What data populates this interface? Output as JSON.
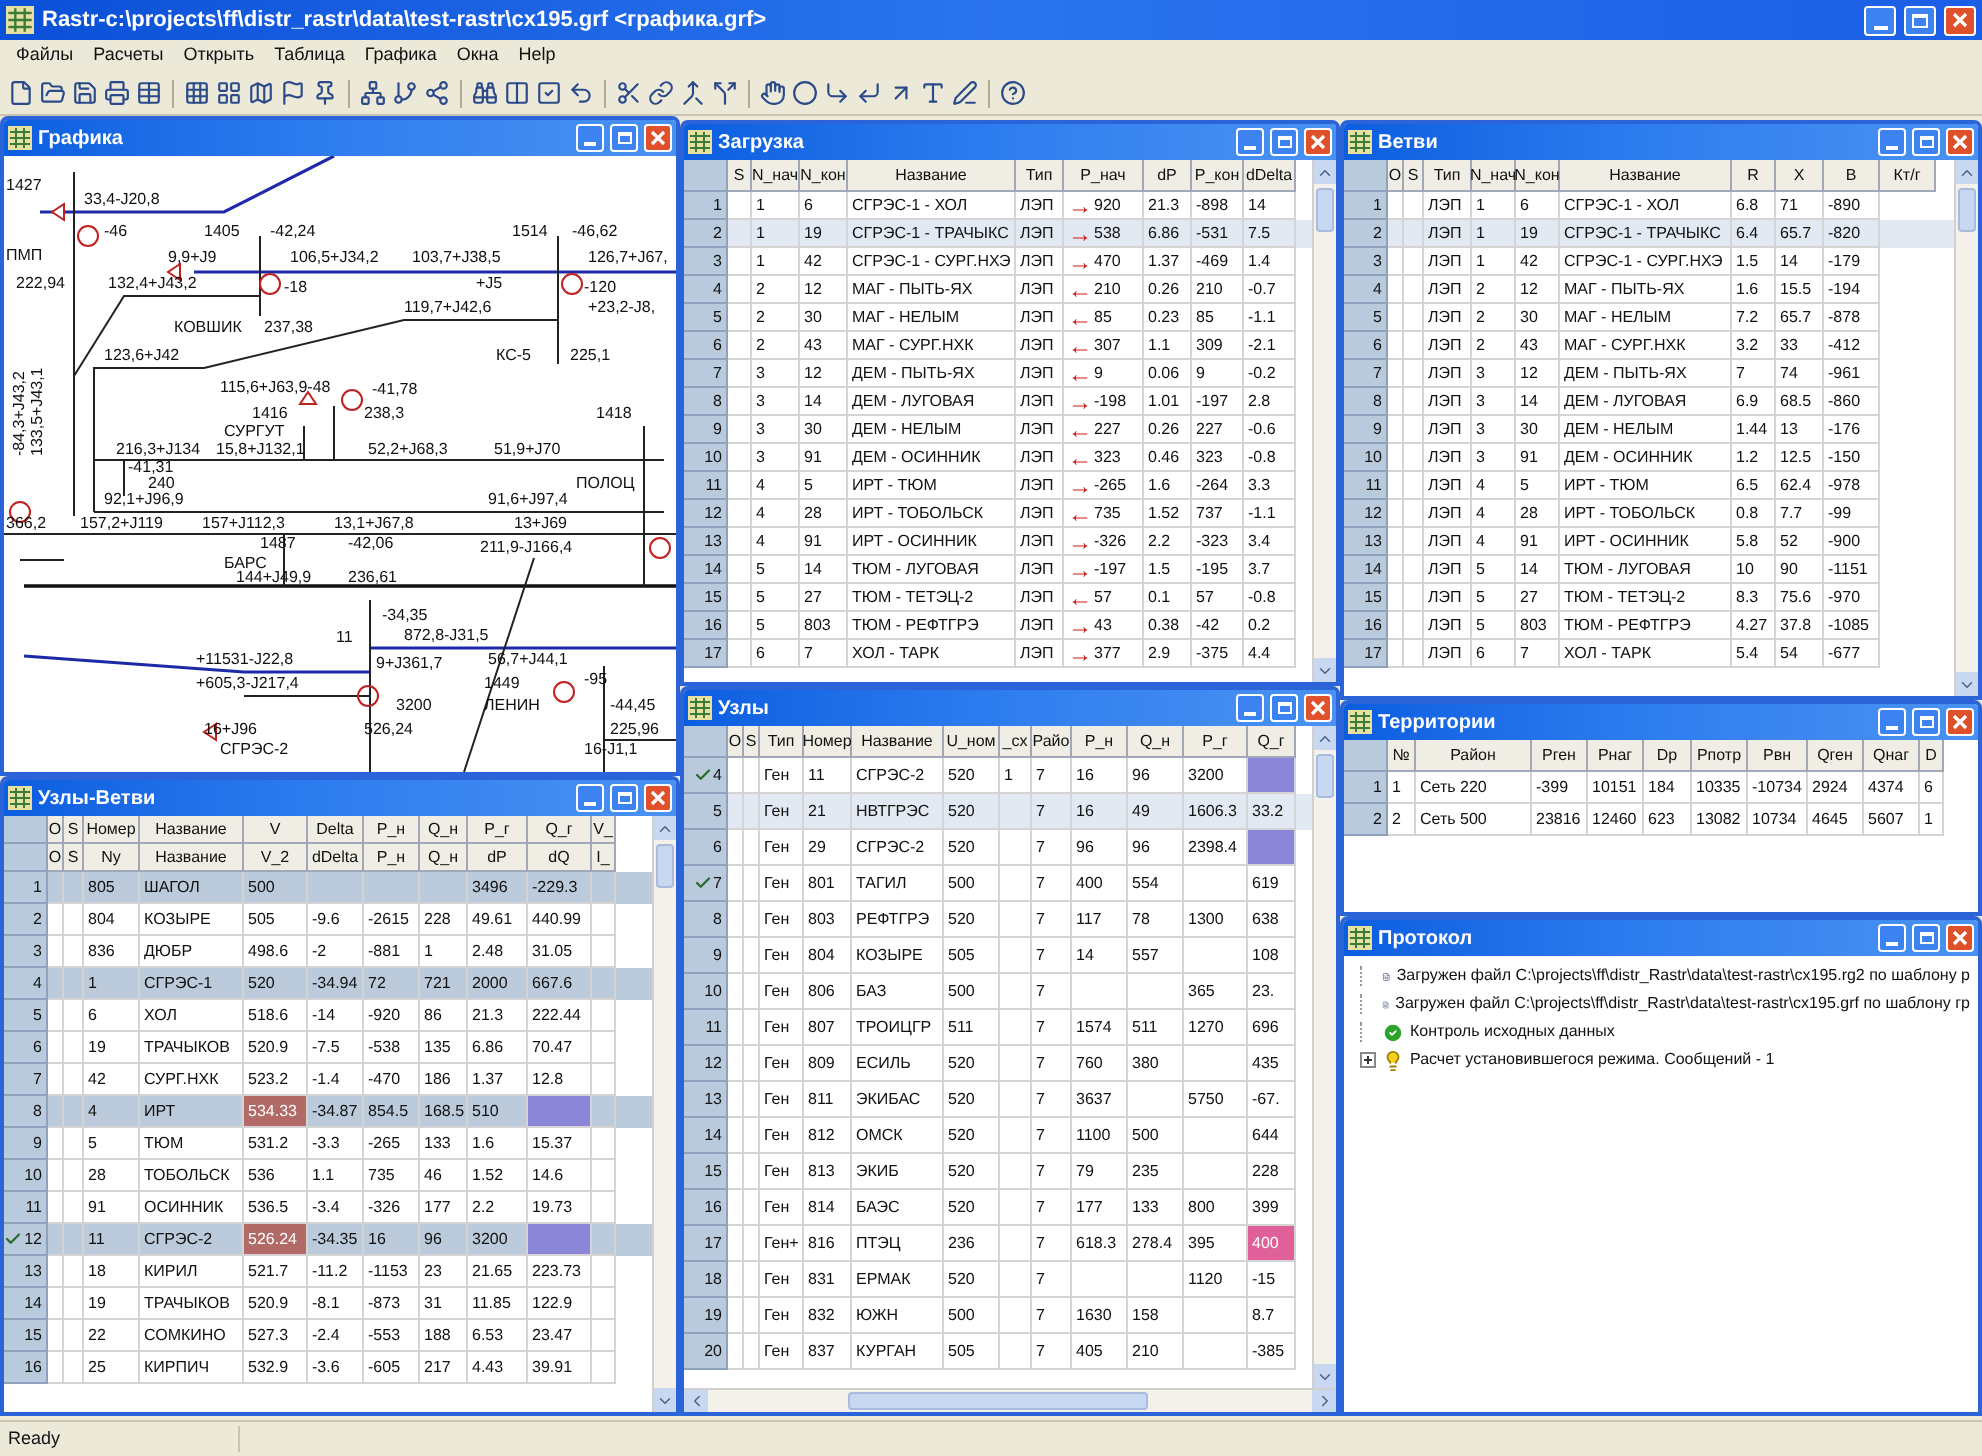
{
  "window": {
    "title": "Rastr-c:\\projects\\ff\\distr_rastr\\data\\test-rastr\\cx195.grf <графика.grf>"
  },
  "menu": [
    "Файлы",
    "Расчеты",
    "Открыть",
    "Таблица",
    "Графика",
    "Окна",
    "Help"
  ],
  "graphics": {
    "title": "Графика",
    "labels": [
      "1427",
      "33,4-J20,8",
      "-46",
      "1405",
      "-42,24",
      "1514",
      "-46,62",
      "ПМП",
      "9,9+J9",
      "106,5+J34,2",
      "103,7+J38,5",
      "126,7+J67,",
      "222,94",
      "132,4+J43,2",
      "-18",
      "+J5",
      "-120",
      "119,7+J42,6",
      "+23,2-J8,",
      "КОВШИК",
      "237,38",
      "123,6+J42",
      "КС-5",
      "225,1",
      "115,6+J63,9-48",
      "-41,78",
      "1416",
      "238,3",
      "1418",
      "СУРГУТ",
      "216,3+J134",
      "15,8+J132,1",
      "52,2+J68,3",
      "51,9+J70",
      "-41,31",
      "240",
      "ПОЛОЦ",
      "92,1+J96,9",
      "91,6+J97,4",
      "366,2",
      "157,2+J119",
      "157+J112,3",
      "13,1+J67,8",
      "13+J69",
      "1487",
      "-42,06",
      "211,9-J166,4",
      "БАРС",
      "144+J49,9",
      "236,61",
      "-34,35",
      "11",
      "872,8-J31,5",
      "+11531-J22,8",
      "9+J361,7",
      "56,7+J44,1",
      "+605,3-J217,4",
      "1449",
      "-95",
      "3200",
      "ЛЕНИН",
      "-44,45",
      "16+J96",
      "526,24",
      "225,96",
      "СГРЭС-2",
      "16-J1,1",
      "-84,3+J43,2",
      "133,5+J43,1"
    ]
  },
  "load": {
    "title": "Загрузка",
    "columns": [
      "S",
      "N_нач",
      "N_кон",
      "Название",
      "Тип",
      "P_нач",
      "dP",
      "P_кон",
      "dDelta"
    ],
    "rows": [
      {
        "number": "1",
        "selected": false,
        "arrow": "→",
        "cells": [
          "",
          "1",
          "6",
          "СГРЭС-1 - ХОЛ",
          "ЛЭП",
          "920",
          "21.3",
          "-898",
          "14"
        ]
      },
      {
        "number": "2",
        "selected": true,
        "arrow": "→",
        "cells": [
          "",
          "1",
          "19",
          "СГРЭС-1 - ТРАЧЫКС",
          "ЛЭП",
          "538",
          "6.86",
          "-531",
          "7.5"
        ]
      },
      {
        "number": "3",
        "selected": false,
        "arrow": "→",
        "cells": [
          "",
          "1",
          "42",
          "СГРЭС-1 - СУРГ.НХЭ",
          "ЛЭП",
          "470",
          "1.37",
          "-469",
          "1.4"
        ]
      },
      {
        "number": "4",
        "selected": false,
        "arrow": "←",
        "cells": [
          "",
          "2",
          "12",
          "МАГ - ПЫТЬ-ЯХ",
          "ЛЭП",
          "210",
          "0.26",
          "210",
          "-0.7"
        ]
      },
      {
        "number": "5",
        "selected": false,
        "arrow": "←",
        "cells": [
          "",
          "2",
          "30",
          "МАГ - НЕЛЫМ",
          "ЛЭП",
          "85",
          "0.23",
          "85",
          "-1.1"
        ]
      },
      {
        "number": "6",
        "selected": false,
        "arrow": "←",
        "cells": [
          "",
          "2",
          "43",
          "МАГ - СУРГ.НХК",
          "ЛЭП",
          "307",
          "1.1",
          "309",
          "-2.1"
        ]
      },
      {
        "number": "7",
        "selected": false,
        "arrow": "←",
        "cells": [
          "",
          "3",
          "12",
          "ДЕМ - ПЫТЬ-ЯХ",
          "ЛЭП",
          "9",
          "0.06",
          "9",
          "-0.2"
        ]
      },
      {
        "number": "8",
        "selected": false,
        "arrow": "→",
        "cells": [
          "",
          "3",
          "14",
          "ДЕМ - ЛУГОВАЯ",
          "ЛЭП",
          "-198",
          "1.01",
          "-197",
          "2.8"
        ]
      },
      {
        "number": "9",
        "selected": false,
        "arrow": "←",
        "cells": [
          "",
          "3",
          "30",
          "ДЕМ - НЕЛЫМ",
          "ЛЭП",
          "227",
          "0.26",
          "227",
          "-0.6"
        ]
      },
      {
        "number": "10",
        "selected": false,
        "arrow": "←",
        "cells": [
          "",
          "3",
          "91",
          "ДЕМ - ОСИННИК",
          "ЛЭП",
          "323",
          "0.46",
          "323",
          "-0.8"
        ]
      },
      {
        "number": "11",
        "selected": false,
        "arrow": "→",
        "cells": [
          "",
          "4",
          "5",
          "ИРТ - ТЮМ",
          "ЛЭП",
          "-265",
          "1.6",
          "-264",
          "3.3"
        ]
      },
      {
        "number": "12",
        "selected": false,
        "arrow": "←",
        "cells": [
          "",
          "4",
          "28",
          "ИРТ - ТОБОЛЬСК",
          "ЛЭП",
          "735",
          "1.52",
          "737",
          "-1.1"
        ]
      },
      {
        "number": "13",
        "selected": false,
        "arrow": "→",
        "cells": [
          "",
          "4",
          "91",
          "ИРТ - ОСИННИК",
          "ЛЭП",
          "-326",
          "2.2",
          "-323",
          "3.4"
        ]
      },
      {
        "number": "14",
        "selected": false,
        "arrow": "→",
        "cells": [
          "",
          "5",
          "14",
          "ТЮМ - ЛУГОВАЯ",
          "ЛЭП",
          "-197",
          "1.5",
          "-195",
          "3.7"
        ]
      },
      {
        "number": "15",
        "selected": false,
        "arrow": "←",
        "cells": [
          "",
          "5",
          "27",
          "ТЮМ - ТЕТЭЦ-2",
          "ЛЭП",
          "57",
          "0.1",
          "57",
          "-0.8"
        ]
      },
      {
        "number": "16",
        "selected": false,
        "arrow": "→",
        "cells": [
          "",
          "5",
          "803",
          "ТЮМ - РЕФТГРЭ",
          "ЛЭП",
          "43",
          "0.38",
          "-42",
          "0.2"
        ]
      },
      {
        "number": "17",
        "selected": false,
        "arrow": "→",
        "cells": [
          "",
          "6",
          "7",
          "ХОЛ - ТАРК",
          "ЛЭП",
          "377",
          "2.9",
          "-375",
          "4.4"
        ]
      }
    ]
  },
  "branches": {
    "title": "Ветви",
    "columns": [
      "О",
      "S",
      "Тип",
      "N_нач",
      "N_кон",
      "Название",
      "R",
      "X",
      "B",
      "Кт/г"
    ],
    "rows": [
      {
        "number": "1",
        "selected": false,
        "cells": [
          "",
          "",
          "ЛЭП",
          "1",
          "6",
          "СГРЭС-1 - ХОЛ",
          "6.8",
          "71",
          "-890"
        ]
      },
      {
        "number": "2",
        "selected": true,
        "cells": [
          "",
          "",
          "ЛЭП",
          "1",
          "19",
          "СГРЭС-1 - ТРАЧЫКС",
          "6.4",
          "65.7",
          "-820"
        ]
      },
      {
        "number": "3",
        "selected": false,
        "cells": [
          "",
          "",
          "ЛЭП",
          "1",
          "42",
          "СГРЭС-1 - СУРГ.НХЭ",
          "1.5",
          "14",
          "-179"
        ]
      },
      {
        "number": "4",
        "selected": false,
        "cells": [
          "",
          "",
          "ЛЭП",
          "2",
          "12",
          "МАГ - ПЫТЬ-ЯХ",
          "1.6",
          "15.5",
          "-194"
        ]
      },
      {
        "number": "5",
        "selected": false,
        "cells": [
          "",
          "",
          "ЛЭП",
          "2",
          "30",
          "МАГ - НЕЛЫМ",
          "7.2",
          "65.7",
          "-878"
        ]
      },
      {
        "number": "6",
        "selected": false,
        "cells": [
          "",
          "",
          "ЛЭП",
          "2",
          "43",
          "МАГ - СУРГ.НХК",
          "3.2",
          "33",
          "-412"
        ]
      },
      {
        "number": "7",
        "selected": false,
        "cells": [
          "",
          "",
          "ЛЭП",
          "3",
          "12",
          "ДЕМ - ПЫТЬ-ЯХ",
          "7",
          "74",
          "-961"
        ]
      },
      {
        "number": "8",
        "selected": false,
        "cells": [
          "",
          "",
          "ЛЭП",
          "3",
          "14",
          "ДЕМ - ЛУГОВАЯ",
          "6.9",
          "68.5",
          "-860"
        ]
      },
      {
        "number": "9",
        "selected": false,
        "cells": [
          "",
          "",
          "ЛЭП",
          "3",
          "30",
          "ДЕМ - НЕЛЫМ",
          "1.44",
          "13",
          "-176"
        ]
      },
      {
        "number": "10",
        "selected": false,
        "cells": [
          "",
          "",
          "ЛЭП",
          "3",
          "91",
          "ДЕМ - ОСИННИК",
          "1.2",
          "12.5",
          "-150"
        ]
      },
      {
        "number": "11",
        "selected": false,
        "cells": [
          "",
          "",
          "ЛЭП",
          "4",
          "5",
          "ИРТ - ТЮМ",
          "6.5",
          "62.4",
          "-978"
        ]
      },
      {
        "number": "12",
        "selected": false,
        "cells": [
          "",
          "",
          "ЛЭП",
          "4",
          "28",
          "ИРТ - ТОБОЛЬСК",
          "0.8",
          "7.7",
          "-99"
        ]
      },
      {
        "number": "13",
        "selected": false,
        "cells": [
          "",
          "",
          "ЛЭП",
          "4",
          "91",
          "ИРТ - ОСИННИК",
          "5.8",
          "52",
          "-900"
        ]
      },
      {
        "number": "14",
        "selected": false,
        "cells": [
          "",
          "",
          "ЛЭП",
          "5",
          "14",
          "ТЮМ - ЛУГОВАЯ",
          "10",
          "90",
          "-1151"
        ]
      },
      {
        "number": "15",
        "selected": false,
        "cells": [
          "",
          "",
          "ЛЭП",
          "5",
          "27",
          "ТЮМ - ТЕТЭЦ-2",
          "8.3",
          "75.6",
          "-970"
        ]
      },
      {
        "number": "16",
        "selected": false,
        "cells": [
          "",
          "",
          "ЛЭП",
          "5",
          "803",
          "ТЮМ - РЕФТГРЭ",
          "4.27",
          "37.8",
          "-1085"
        ]
      },
      {
        "number": "17",
        "selected": false,
        "cells": [
          "",
          "",
          "ЛЭП",
          "6",
          "7",
          "ХОЛ - ТАРК",
          "5.4",
          "54",
          "-677"
        ]
      }
    ]
  },
  "nodes_branches": {
    "title": "Узлы-Ветви",
    "columns": [
      "О",
      "S",
      "Номер",
      "Название",
      "V",
      "Delta",
      "P_н",
      "Q_н",
      "P_г",
      "Q_г",
      "V_"
    ],
    "subcolumns": [
      "О",
      "S",
      "Ny",
      "Название",
      "V_2",
      "dDelta",
      "P_н",
      "Q_н",
      "dP",
      "dQ",
      "I_"
    ],
    "rows": [
      {
        "number": "1",
        "kind": "node",
        "checked": false,
        "cells": [
          "",
          "",
          "805",
          "ШАГОЛ",
          "500",
          "",
          "",
          "",
          "3496",
          "-229.3"
        ]
      },
      {
        "number": "2",
        "kind": "branch",
        "checked": false,
        "cells": [
          "",
          "",
          "804",
          "КОЗЫРЕ",
          "505",
          "-9.6",
          "-2615",
          "228",
          "49.61",
          "440.99"
        ]
      },
      {
        "number": "3",
        "kind": "branch",
        "checked": false,
        "cells": [
          "",
          "",
          "836",
          "ДЮБР",
          "498.6",
          "-2",
          "-881",
          "1",
          "2.48",
          "31.05"
        ]
      },
      {
        "number": "4",
        "kind": "node",
        "checked": false,
        "cells": [
          "",
          "",
          "1",
          "СГРЭС-1",
          "520",
          "-34.94",
          "72",
          "721",
          "2000",
          "667.6"
        ]
      },
      {
        "number": "5",
        "kind": "branch",
        "checked": false,
        "cells": [
          "",
          "",
          "6",
          "ХОЛ",
          "518.6",
          "-14",
          "-920",
          "86",
          "21.3",
          "222.44"
        ]
      },
      {
        "number": "6",
        "kind": "branch",
        "checked": false,
        "cells": [
          "",
          "",
          "19",
          "ТРАЧЫКОВ",
          "520.9",
          "-7.5",
          "-538",
          "135",
          "6.86",
          "70.47"
        ]
      },
      {
        "number": "7",
        "kind": "branch",
        "checked": false,
        "cells": [
          "",
          "",
          "42",
          "СУРГ.НХК",
          "523.2",
          "-1.4",
          "-470",
          "186",
          "1.37",
          "12.8"
        ]
      },
      {
        "number": "8",
        "kind": "node",
        "checked": false,
        "cells": [
          "",
          "",
          "4",
          "ИРТ",
          {
            "text": "534.33",
            "color": "#b26a66"
          },
          "-34.87",
          "854.5",
          "168.5",
          "510",
          {
            "color": "#8c86d8"
          }
        ]
      },
      {
        "number": "9",
        "kind": "branch",
        "checked": false,
        "cells": [
          "",
          "",
          "5",
          "ТЮМ",
          "531.2",
          "-3.3",
          "-265",
          "133",
          "1.6",
          "15.37"
        ]
      },
      {
        "number": "10",
        "kind": "branch",
        "checked": false,
        "cells": [
          "",
          "",
          "28",
          "ТОБОЛЬСК",
          "536",
          "1.1",
          "735",
          "46",
          "1.52",
          "14.6"
        ]
      },
      {
        "number": "11",
        "kind": "branch",
        "checked": false,
        "cells": [
          "",
          "",
          "91",
          "ОСИННИК",
          "536.5",
          "-3.4",
          "-326",
          "177",
          "2.2",
          "19.73"
        ]
      },
      {
        "number": "12",
        "kind": "node",
        "checked": true,
        "cells": [
          "",
          "",
          "11",
          "СГРЭС-2",
          {
            "text": "526.24",
            "color": "#b26a66"
          },
          "-34.35",
          "16",
          "96",
          "3200",
          {
            "color": "#8c86d8"
          }
        ]
      },
      {
        "number": "13",
        "kind": "branch",
        "checked": false,
        "cells": [
          "",
          "",
          "18",
          "КИРИЛ",
          "521.7",
          "-11.2",
          "-1153",
          "23",
          "21.65",
          "223.73"
        ]
      },
      {
        "number": "14",
        "kind": "branch",
        "checked": false,
        "cells": [
          "",
          "",
          "19",
          "ТРАЧЫКОВ",
          "520.9",
          "-8.1",
          "-873",
          "31",
          "11.85",
          "122.9"
        ]
      },
      {
        "number": "15",
        "kind": "branch",
        "checked": false,
        "cells": [
          "",
          "",
          "22",
          "СОМКИНО",
          "527.3",
          "-2.4",
          "-553",
          "188",
          "6.53",
          "23.47"
        ]
      },
      {
        "number": "16",
        "kind": "branch",
        "checked": false,
        "cells": [
          "",
          "",
          "25",
          "КИРПИЧ",
          "532.9",
          "-3.6",
          "-605",
          "217",
          "4.43",
          "39.91"
        ]
      }
    ]
  },
  "nodes": {
    "title": "Узлы",
    "columns": [
      "О",
      "S",
      "Тип",
      "Номер",
      "Название",
      "U_ном",
      "_сх",
      "Райо",
      "P_н",
      "Q_н",
      "P_г",
      "Q_г"
    ],
    "rows": [
      {
        "number": "4",
        "checked": true,
        "selected": false,
        "cells": [
          "",
          "",
          "Ген",
          "11",
          "СГРЭС-2",
          "520",
          "1",
          "7",
          "16",
          "96",
          "3200",
          {
            "color": "#8c86d8"
          }
        ]
      },
      {
        "number": "5",
        "checked": false,
        "selected": true,
        "cells": [
          "",
          "",
          "Ген",
          "21",
          "НВТГРЭС",
          "520",
          "",
          "7",
          "16",
          "49",
          "1606.3",
          "33.2"
        ]
      },
      {
        "number": "6",
        "checked": false,
        "selected": false,
        "cells": [
          "",
          "",
          "Ген",
          "29",
          "СГРЭС-2",
          "520",
          "",
          "7",
          "96",
          "96",
          "2398.4",
          {
            "color": "#8c86d8"
          }
        ]
      },
      {
        "number": "7",
        "checked": true,
        "selected": false,
        "cells": [
          "",
          "",
          "Ген",
          "801",
          "ТАГИЛ",
          "500",
          "",
          "7",
          "400",
          "554",
          "",
          "619"
        ]
      },
      {
        "number": "8",
        "checked": false,
        "selected": false,
        "cells": [
          "",
          "",
          "Ген",
          "803",
          "РЕФТГРЭ",
          "520",
          "",
          "7",
          "117",
          "78",
          "1300",
          "638"
        ]
      },
      {
        "number": "9",
        "checked": false,
        "selected": false,
        "cells": [
          "",
          "",
          "Ген",
          "804",
          "КОЗЫРЕ",
          "505",
          "",
          "7",
          "14",
          "557",
          "",
          "108"
        ]
      },
      {
        "number": "10",
        "checked": false,
        "selected": false,
        "cells": [
          "",
          "",
          "Ген",
          "806",
          "БАЗ",
          "500",
          "",
          "7",
          "",
          "",
          "365",
          "23."
        ]
      },
      {
        "number": "11",
        "checked": false,
        "selected": false,
        "cells": [
          "",
          "",
          "Ген",
          "807",
          "ТРОИЦГР",
          "511",
          "",
          "7",
          "1574",
          "511",
          "1270",
          "696"
        ]
      },
      {
        "number": "12",
        "checked": false,
        "selected": false,
        "cells": [
          "",
          "",
          "Ген",
          "809",
          "ЕСИЛЬ",
          "520",
          "",
          "7",
          "760",
          "380",
          "",
          "435"
        ]
      },
      {
        "number": "13",
        "checked": false,
        "selected": false,
        "cells": [
          "",
          "",
          "Ген",
          "811",
          "ЭКИБАС",
          "520",
          "",
          "7",
          "3637",
          "",
          "5750",
          "-67."
        ]
      },
      {
        "number": "14",
        "checked": false,
        "selected": false,
        "cells": [
          "",
          "",
          "Ген",
          "812",
          "ОМСК",
          "520",
          "",
          "7",
          "1100",
          "500",
          "",
          "644"
        ]
      },
      {
        "number": "15",
        "checked": false,
        "selected": false,
        "cells": [
          "",
          "",
          "Ген",
          "813",
          "ЭКИБ",
          "520",
          "",
          "7",
          "79",
          "235",
          "",
          "228"
        ]
      },
      {
        "number": "16",
        "checked": false,
        "selected": false,
        "cells": [
          "",
          "",
          "Ген",
          "814",
          "БАЭС",
          "520",
          "",
          "7",
          "177",
          "133",
          "800",
          "399"
        ]
      },
      {
        "number": "17",
        "checked": false,
        "selected": false,
        "cells": [
          "",
          "",
          "Ген+",
          "816",
          "ПТЭЦ",
          "236",
          "",
          "7",
          "618.3",
          "278.4",
          "395",
          {
            "text": "400",
            "color": "#e0609a"
          }
        ]
      },
      {
        "number": "18",
        "checked": false,
        "selected": false,
        "cells": [
          "",
          "",
          "Ген",
          "831",
          "ЕРМАК",
          "520",
          "",
          "7",
          "",
          "",
          "1120",
          "-15"
        ]
      },
      {
        "number": "19",
        "checked": false,
        "selected": false,
        "cells": [
          "",
          "",
          "Ген",
          "832",
          "ЮЖН",
          "500",
          "",
          "7",
          "1630",
          "158",
          "",
          "8.7"
        ]
      },
      {
        "number": "20",
        "checked": false,
        "selected": false,
        "cells": [
          "",
          "",
          "Ген",
          "837",
          "КУРГАН",
          "505",
          "",
          "7",
          "405",
          "210",
          "",
          "-385"
        ]
      }
    ]
  },
  "territories": {
    "title": "Территории",
    "columns": [
      "№",
      "Район",
      "Pген",
      "Pнаг",
      "Dp",
      "Pпотр",
      "Pвн",
      "Qген",
      "Qнаг",
      "D"
    ],
    "rows": [
      {
        "number": "1",
        "cells": [
          "1",
          "Сеть 220",
          "-399",
          "10151",
          "184",
          "10335",
          "-10734",
          "2924",
          "4374",
          "6"
        ]
      },
      {
        "number": "2",
        "cells": [
          "2",
          "Сеть 500",
          "23816",
          "12460",
          "623",
          "13082",
          "10734",
          "4645",
          "5607",
          "1"
        ]
      }
    ]
  },
  "protocol": {
    "title": "Протокол",
    "items": [
      {
        "kind": "file",
        "text": "Загружен файл C:\\projects\\ff\\distr_Rastr\\data\\test-rastr\\cx195.rg2 по шаблону р"
      },
      {
        "kind": "file",
        "text": "Загружен файл C:\\projects\\ff\\distr_Rastr\\data\\test-rastr\\cx195.grf по шаблону гр"
      },
      {
        "kind": "check",
        "text": "Контроль исходных данных"
      },
      {
        "kind": "info",
        "expanded": false,
        "text": "Расчет установившегося режима. Сообщений - 1"
      }
    ]
  },
  "status_bar": {
    "text": "Ready"
  }
}
